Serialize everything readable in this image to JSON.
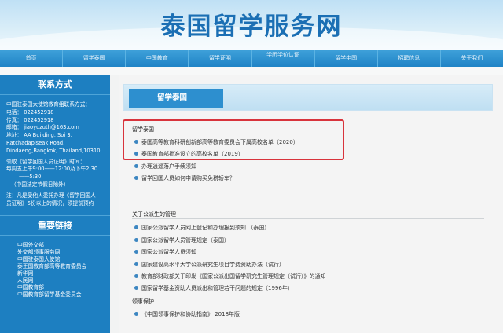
{
  "site_title": "泰国留学服务网",
  "nav": [
    "首页",
    "留学泰国",
    "中国教育",
    "留学证明",
    "学历学位认证",
    "留学中国",
    "招聘信息",
    "关于我们"
  ],
  "sidebar": {
    "contact_title": "联系方式",
    "contact_lines": [
      "中国驻泰国大使馆教育组联系方式：",
      "电话： 022452918",
      "传真： 022452918",
      "邮箱： jiaoyuzuth@163.com",
      "地址： AA Building, Soi 3,",
      "Ratchadapiseak Road,",
      "Dindaeng,Bangkok, Thailand,10310"
    ],
    "hours_lines": [
      "领取《留学回国人员证明》时间：",
      "每周五上午9:00——12:00及下午2:30",
      "——5:30",
      "（中国法定节假日除外）"
    ],
    "notice_lines": [
      "注：凡是受他人委托办理《留学回国人",
      "员证明》5份以上的情况，须提前预约"
    ],
    "links_title": "重要链接",
    "links": [
      "中国外交部",
      "外交部领事服务网",
      "中国驻泰国大使馆",
      "泰王国教育部高等教育委员会",
      "新华网",
      "人民网",
      "中国教育部",
      "中国教育部留学基金委员会"
    ]
  },
  "main": {
    "tab_label": "留学泰国",
    "sections": [
      {
        "title": "留学泰国",
        "items": [
          "泰国高等教育科研创新部高等教育委员会下属高校名单（2020）",
          "泰国教育部批准设立的高校名单（2019）",
          "办理逍遥落户手续须知",
          "留学回国人员如何申请购买免税轿车？"
        ]
      },
      {
        "title": "关于公派生的管理",
        "items": [
          "国家公派留学人员网上登记和办理报到须知 （泰国）",
          "国家公派留学人员管理规定（泰国）",
          "国家公派留学人员须知",
          "国家建设高水平大学公派研究生项目学费资助办法（试行）",
          "教育部财政部关于印发《国家公派出国留学研究生管理规定（试行）》的通知",
          "国家留学基金资助人员派出和管理若干问题的规定（1996年）"
        ]
      },
      {
        "title": "领事保护",
        "items": [
          "《中国领事保护和协助指南》 2018年版"
        ]
      }
    ]
  },
  "colors": {
    "brand_blue": "#1d7fc1",
    "title_blue": "#1b6fb4",
    "highlight_red": "#d8343c"
  }
}
